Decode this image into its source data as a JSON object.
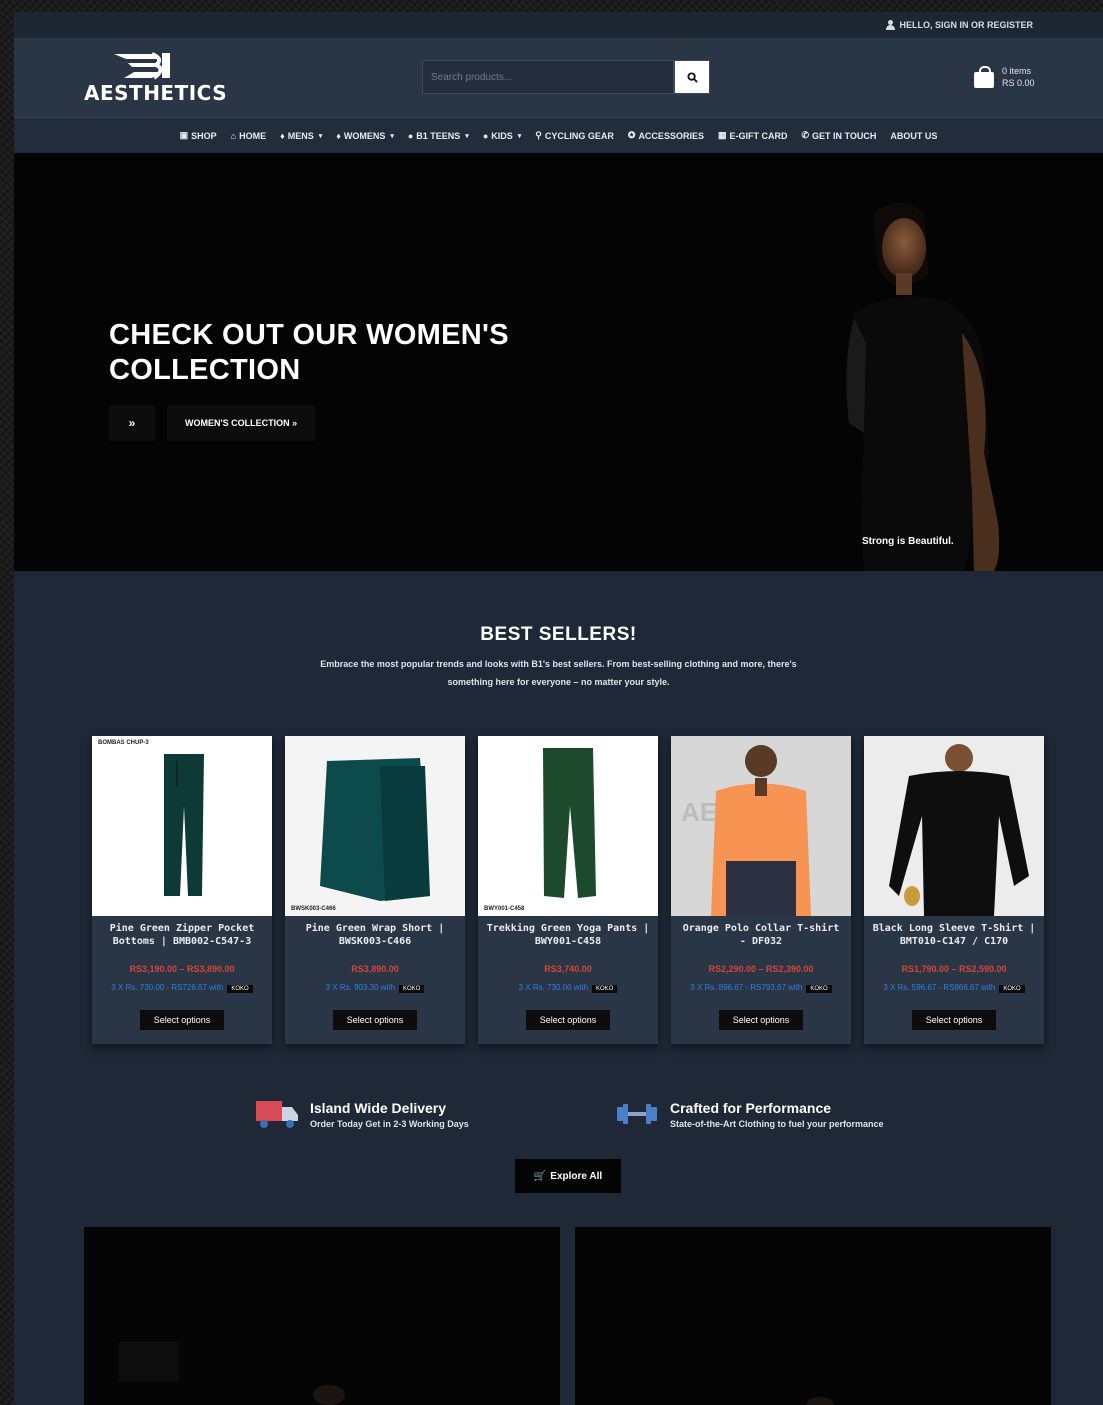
{
  "topbar": {
    "account_text": "Hello, SIGN IN or REGISTER"
  },
  "header": {
    "logo_text": "AESTHETICS",
    "search_placeholder": "Search products...",
    "cart_items": "0 items",
    "cart_total": "RS 0.00"
  },
  "nav": [
    {
      "label": "SHOP",
      "icon": "shop-icon",
      "glyph": "▣",
      "dropdown": false
    },
    {
      "label": "HOME",
      "icon": "home-icon",
      "glyph": "⌂",
      "dropdown": false
    },
    {
      "label": "MENS",
      "icon": "male-icon",
      "glyph": "♦",
      "dropdown": true
    },
    {
      "label": "WOMENS",
      "icon": "female-icon",
      "glyph": "♦",
      "dropdown": true
    },
    {
      "label": "B1 TEENS",
      "icon": "teens-icon",
      "glyph": "●",
      "dropdown": true
    },
    {
      "label": "KIDS",
      "icon": "kids-icon",
      "glyph": "●",
      "dropdown": true
    },
    {
      "label": "CYCLING GEAR",
      "icon": "bicycle-icon",
      "glyph": "⚲",
      "dropdown": false
    },
    {
      "label": "ACCESSORIES",
      "icon": "accessories-icon",
      "glyph": "✪",
      "dropdown": false
    },
    {
      "label": "E-GIFT CARD",
      "icon": "gift-icon",
      "glyph": "▦",
      "dropdown": false
    },
    {
      "label": "GET IN TOUCH",
      "icon": "phone-icon",
      "glyph": "✆",
      "dropdown": false
    },
    {
      "label": "ABOUT US",
      "icon": "",
      "glyph": "",
      "dropdown": false
    }
  ],
  "hero": {
    "title": "CHECK OUT OUR WOMEN'S COLLECTION",
    "small_button": "»",
    "button_label": "WOMEN'S COLLECTION »",
    "caption": "Strong is Beautiful."
  },
  "best_sellers": {
    "title": "BEST SELLERS!",
    "subtitle": "Embrace the most popular trends and looks with B1's best sellers. From best-selling clothing and more, there's something here for everyone – no matter your style.",
    "products": [
      {
        "name": "Pine Green Zipper Pocket Bottoms | BMB002-C547-3",
        "price": "RS3,190.00 – RS3,890.00",
        "koko": "3 X Rs. 730.00 - RS726.67 with",
        "button": "Select options",
        "image_label": "BOMBAS CHUP-3"
      },
      {
        "name": "Pine Green Wrap Short | BWSK003-C466",
        "price": "RS3,890.00",
        "koko": "3 X Rs. 903.30 with",
        "button": "Select options",
        "image_label": "BWSK003-C466"
      },
      {
        "name": "Trekking Green Yoga Pants | BWY001-C458",
        "price": "RS3,740.00",
        "koko": "3 X Rs. 730.00 with",
        "button": "Select options",
        "image_label": "BWY001-C458"
      },
      {
        "name": "Orange Polo Collar T-shirt - DF032",
        "price": "RS2,290.00 – RS2,390.00",
        "koko": "3 X Rs. 896.67 - RS793.67 with",
        "button": "Select options",
        "image_label": ""
      },
      {
        "name": "Black Long Sleeve T-Shirt | BMT010-C147 / C170",
        "price": "RS1,790.00 – RS2,590.00",
        "koko": "3 X Rs. 596.67 - RS866.67 with",
        "button": "Select options",
        "image_label": ""
      }
    ],
    "koko_tag": "KOKO"
  },
  "features": [
    {
      "title": "Island Wide Delivery",
      "subtitle": "Order Today Get in 2-3 Working Days"
    },
    {
      "title": "Crafted for Performance",
      "subtitle": "State-of-the-Art Clothing to fuel your performance"
    }
  ],
  "explore_label": "Explore All",
  "colors": {
    "background": "#1e2836",
    "header": "#2a3545",
    "price_red": "#d2473a",
    "koko_blue": "#2f7fe6"
  }
}
